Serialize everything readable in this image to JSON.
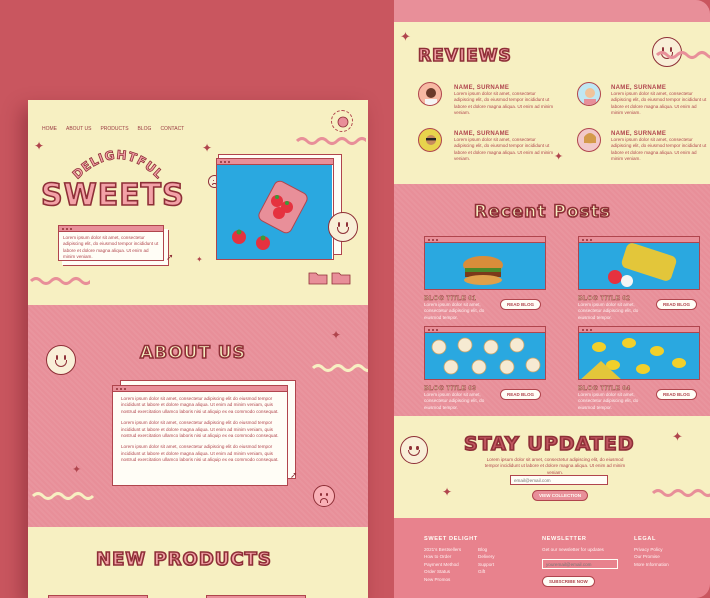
{
  "left": {
    "nav": [
      "HOME",
      "ABOUT US",
      "PRODUCTS",
      "BLOG",
      "CONTACT"
    ],
    "logo_text": "SWEET DELIGHT",
    "hero": {
      "kicker": "DELIGHTFUL",
      "title": "SWEETS",
      "text": "Lorem ipsum dolor sit amet, consectetur adipiscing elit, do eiusmod tempor incididunt ut labore et dolore magna aliqua. Ut enim ad minim veniam."
    },
    "about": {
      "title": "ABOUT US",
      "paragraphs": [
        "Lorem ipsum dolor sit amet, consectetur adipiscing elit do eiusmod tempor incididunt ut labore et dolore magna aliqua. Ut enim ad minim veniam, quis nostrud exercitation ullamco laboris nisi ut aliquip ex ea commodo consequat.",
        "Lorem ipsum dolor sit amet, consectetur adipiscing elit do eiusmod tempor incididunt ut labore et dolore magna aliqua. Ut enim ad minim veniam, quis nostrud exercitation ullamco laboris nisi ut aliquip ex ea commodo consequat.",
        "Lorem ipsum dolor sit amet, consectetur adipiscing elit do eiusmod tempor incididunt ut labore et dolore magna aliqua. Ut enim ad minim veniam, quis nostrud exercitation ullamco laboris nisi ut aliquip ex ea commodo consequat."
      ]
    },
    "products_title": "NEW PRODUCTS"
  },
  "right": {
    "reviews_title": "REVIEWS",
    "reviews": [
      {
        "name": "NAME, SURNAME",
        "text": "Lorem ipsum dolor sit amet, consectetur adipiscing elit, do eiusmod tempor incididunt ut labore et dolore magna aliqua. Ut enim ad minim veniam."
      },
      {
        "name": "NAME, SURNAME",
        "text": "Lorem ipsum dolor sit amet, consectetur adipiscing elit, do eiusmod tempor incididunt ut labore et dolore magna aliqua. Ut enim ad minim veniam."
      },
      {
        "name": "NAME, SURNAME",
        "text": "Lorem ipsum dolor sit amet, consectetur adipiscing elit, do eiusmod tempor incididunt ut labore et dolore magna aliqua. Ut enim ad minim veniam."
      },
      {
        "name": "NAME, SURNAME",
        "text": "Lorem ipsum dolor sit amet, consectetur adipiscing elit, do eiusmod tempor incididunt ut labore et dolore magna aliqua. Ut enim ad minim veniam."
      }
    ],
    "posts_title": "Recent Posts",
    "posts": [
      {
        "title": "BLOG TITLE 01",
        "text": "Lorem ipsum dolor sit amet, consectetur adipiscing elit, do eiusmod tempor.",
        "button": "READ BLOG"
      },
      {
        "title": "BLOG TITLE 02",
        "text": "Lorem ipsum dolor sit amet, consectetur adipiscing elit, do eiusmod tempor.",
        "button": "READ BLOG"
      },
      {
        "title": "BLOG TITLE 03",
        "text": "Lorem ipsum dolor sit amet, consectetur adipiscing elit, do eiusmod tempor.",
        "button": "READ BLOG"
      },
      {
        "title": "BLOG TITLE 04",
        "text": "Lorem ipsum dolor sit amet, consectetur adipiscing elit, do eiusmod tempor.",
        "button": "READ BLOG"
      }
    ],
    "stay": {
      "title": "STAY UPDATED",
      "text": "Lorem ipsum dolor sit amet, consectetur adipiscing elit, do eiusmod tempor incididunt ut labore et dolore magna aliqua. Ut enim ad minim veniam.",
      "input_placeholder": "email@email.com",
      "button": "VIEW COLLECTION"
    },
    "footer": {
      "brand": "SWEET DELIGHT",
      "col1": [
        "2021's Bestsellers",
        "How to Order",
        "Payment Method",
        "Order Status",
        "New Promos"
      ],
      "col2": [
        "Blog",
        "Delivery",
        "Support",
        "Gift"
      ],
      "newsletter_title": "NEWSLETTER",
      "newsletter_text": "Get our newsletter for updates",
      "newsletter_placeholder": "youremail@email.com",
      "subscribe": "SUBSCRIBE NOW",
      "legal_title": "LEGAL",
      "legal": [
        "Privacy Policy",
        "Our Promise",
        "More Information"
      ]
    }
  }
}
